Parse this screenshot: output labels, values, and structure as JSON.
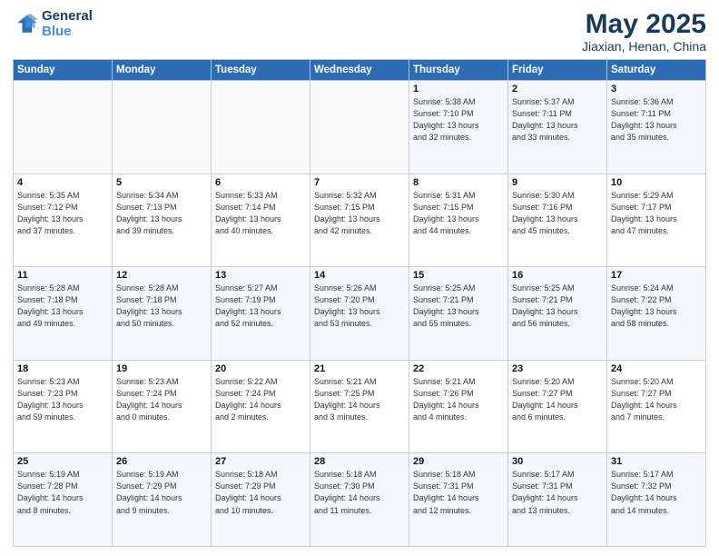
{
  "header": {
    "logo_line1": "General",
    "logo_line2": "Blue",
    "title": "May 2025",
    "subtitle": "Jiaxian, Henan, China"
  },
  "days_of_week": [
    "Sunday",
    "Monday",
    "Tuesday",
    "Wednesday",
    "Thursday",
    "Friday",
    "Saturday"
  ],
  "weeks": [
    [
      {
        "day": "",
        "info": ""
      },
      {
        "day": "",
        "info": ""
      },
      {
        "day": "",
        "info": ""
      },
      {
        "day": "",
        "info": ""
      },
      {
        "day": "1",
        "info": "Sunrise: 5:38 AM\nSunset: 7:10 PM\nDaylight: 13 hours\nand 32 minutes."
      },
      {
        "day": "2",
        "info": "Sunrise: 5:37 AM\nSunset: 7:11 PM\nDaylight: 13 hours\nand 33 minutes."
      },
      {
        "day": "3",
        "info": "Sunrise: 5:36 AM\nSunset: 7:11 PM\nDaylight: 13 hours\nand 35 minutes."
      }
    ],
    [
      {
        "day": "4",
        "info": "Sunrise: 5:35 AM\nSunset: 7:12 PM\nDaylight: 13 hours\nand 37 minutes."
      },
      {
        "day": "5",
        "info": "Sunrise: 5:34 AM\nSunset: 7:13 PM\nDaylight: 13 hours\nand 39 minutes."
      },
      {
        "day": "6",
        "info": "Sunrise: 5:33 AM\nSunset: 7:14 PM\nDaylight: 13 hours\nand 40 minutes."
      },
      {
        "day": "7",
        "info": "Sunrise: 5:32 AM\nSunset: 7:15 PM\nDaylight: 13 hours\nand 42 minutes."
      },
      {
        "day": "8",
        "info": "Sunrise: 5:31 AM\nSunset: 7:15 PM\nDaylight: 13 hours\nand 44 minutes."
      },
      {
        "day": "9",
        "info": "Sunrise: 5:30 AM\nSunset: 7:16 PM\nDaylight: 13 hours\nand 45 minutes."
      },
      {
        "day": "10",
        "info": "Sunrise: 5:29 AM\nSunset: 7:17 PM\nDaylight: 13 hours\nand 47 minutes."
      }
    ],
    [
      {
        "day": "11",
        "info": "Sunrise: 5:28 AM\nSunset: 7:18 PM\nDaylight: 13 hours\nand 49 minutes."
      },
      {
        "day": "12",
        "info": "Sunrise: 5:28 AM\nSunset: 7:18 PM\nDaylight: 13 hours\nand 50 minutes."
      },
      {
        "day": "13",
        "info": "Sunrise: 5:27 AM\nSunset: 7:19 PM\nDaylight: 13 hours\nand 52 minutes."
      },
      {
        "day": "14",
        "info": "Sunrise: 5:26 AM\nSunset: 7:20 PM\nDaylight: 13 hours\nand 53 minutes."
      },
      {
        "day": "15",
        "info": "Sunrise: 5:25 AM\nSunset: 7:21 PM\nDaylight: 13 hours\nand 55 minutes."
      },
      {
        "day": "16",
        "info": "Sunrise: 5:25 AM\nSunset: 7:21 PM\nDaylight: 13 hours\nand 56 minutes."
      },
      {
        "day": "17",
        "info": "Sunrise: 5:24 AM\nSunset: 7:22 PM\nDaylight: 13 hours\nand 58 minutes."
      }
    ],
    [
      {
        "day": "18",
        "info": "Sunrise: 5:23 AM\nSunset: 7:23 PM\nDaylight: 13 hours\nand 59 minutes."
      },
      {
        "day": "19",
        "info": "Sunrise: 5:23 AM\nSunset: 7:24 PM\nDaylight: 14 hours\nand 0 minutes."
      },
      {
        "day": "20",
        "info": "Sunrise: 5:22 AM\nSunset: 7:24 PM\nDaylight: 14 hours\nand 2 minutes."
      },
      {
        "day": "21",
        "info": "Sunrise: 5:21 AM\nSunset: 7:25 PM\nDaylight: 14 hours\nand 3 minutes."
      },
      {
        "day": "22",
        "info": "Sunrise: 5:21 AM\nSunset: 7:26 PM\nDaylight: 14 hours\nand 4 minutes."
      },
      {
        "day": "23",
        "info": "Sunrise: 5:20 AM\nSunset: 7:27 PM\nDaylight: 14 hours\nand 6 minutes."
      },
      {
        "day": "24",
        "info": "Sunrise: 5:20 AM\nSunset: 7:27 PM\nDaylight: 14 hours\nand 7 minutes."
      }
    ],
    [
      {
        "day": "25",
        "info": "Sunrise: 5:19 AM\nSunset: 7:28 PM\nDaylight: 14 hours\nand 8 minutes."
      },
      {
        "day": "26",
        "info": "Sunrise: 5:19 AM\nSunset: 7:29 PM\nDaylight: 14 hours\nand 9 minutes."
      },
      {
        "day": "27",
        "info": "Sunrise: 5:18 AM\nSunset: 7:29 PM\nDaylight: 14 hours\nand 10 minutes."
      },
      {
        "day": "28",
        "info": "Sunrise: 5:18 AM\nSunset: 7:30 PM\nDaylight: 14 hours\nand 11 minutes."
      },
      {
        "day": "29",
        "info": "Sunrise: 5:18 AM\nSunset: 7:31 PM\nDaylight: 14 hours\nand 12 minutes."
      },
      {
        "day": "30",
        "info": "Sunrise: 5:17 AM\nSunset: 7:31 PM\nDaylight: 14 hours\nand 13 minutes."
      },
      {
        "day": "31",
        "info": "Sunrise: 5:17 AM\nSunset: 7:32 PM\nDaylight: 14 hours\nand 14 minutes."
      }
    ]
  ]
}
